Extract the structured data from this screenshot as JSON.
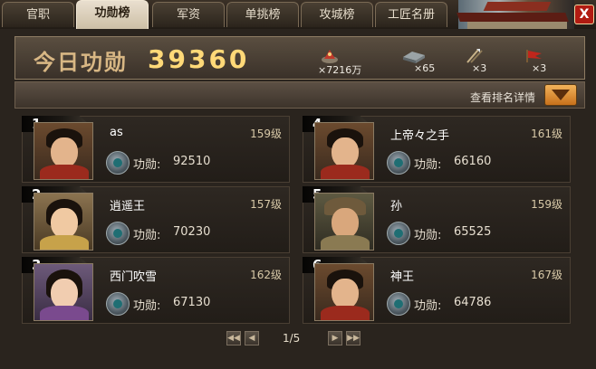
{
  "tabs": [
    {
      "label": "官职",
      "active": false
    },
    {
      "label": "功勋榜",
      "active": true
    },
    {
      "label": "军资",
      "active": false
    },
    {
      "label": "单挑榜",
      "active": false
    },
    {
      "label": "攻城榜",
      "active": false
    },
    {
      "label": "工匠名册",
      "active": false
    }
  ],
  "close_label": "X",
  "header": {
    "merit_label": "今日功勋",
    "merit_value": "39360",
    "resources": [
      {
        "icon": "silver-coin-icon",
        "value": "×7216万"
      },
      {
        "icon": "iron-ingot-icon",
        "value": "×65"
      },
      {
        "icon": "weapon-bundle-icon",
        "value": "×3"
      },
      {
        "icon": "banner-flag-icon",
        "value": "×3"
      }
    ]
  },
  "detail_link": "查看排名详情",
  "ranking": [
    {
      "rank": "1",
      "name": "as",
      "level": "159级",
      "merit_label": "功勋:",
      "merit": "92510",
      "portrait": "male-red-armor"
    },
    {
      "rank": "2",
      "name": "逍遥王",
      "level": "157级",
      "merit_label": "功勋:",
      "merit": "70230",
      "portrait": "female-gold"
    },
    {
      "rank": "3",
      "name": "西门吹雪",
      "level": "162级",
      "merit_label": "功勋:",
      "merit": "67130",
      "portrait": "female-purple"
    },
    {
      "rank": "4",
      "name": "上帝々之手",
      "level": "161级",
      "merit_label": "功勋:",
      "merit": "66160",
      "portrait": "male-red-armor"
    },
    {
      "rank": "5",
      "name": "孙",
      "level": "159级",
      "merit_label": "功勋:",
      "merit": "65525",
      "portrait": "male-helmet"
    },
    {
      "rank": "6",
      "name": "神王",
      "level": "167级",
      "merit_label": "功勋:",
      "merit": "64786",
      "portrait": "male-red-armor"
    }
  ],
  "pager": {
    "text": "1/5"
  },
  "colors": {
    "accent_gold": "#ffd978",
    "tab_active": "#e9dfcf",
    "close_red": "#b11b12",
    "dropdown_orange": "#e08a2a"
  }
}
